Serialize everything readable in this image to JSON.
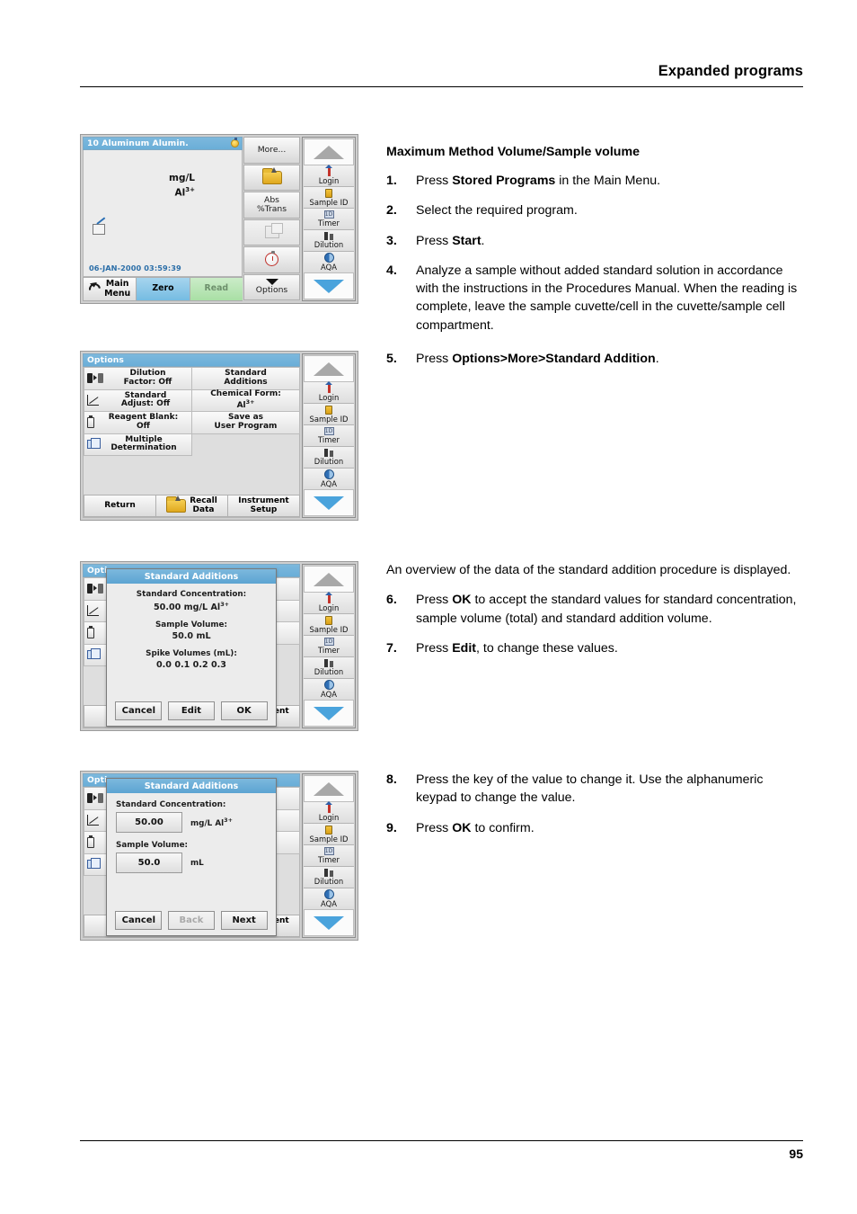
{
  "header": {
    "title": "Expanded programs"
  },
  "footer": {
    "page_number": "95"
  },
  "instructions": {
    "section_title": "Maximum Method Volume/Sample volume",
    "steps": [
      {
        "num": "1.",
        "pre": "Press ",
        "bold": "Stored Programs",
        "post": " in the Main Menu."
      },
      {
        "num": "2.",
        "pre": "Select the required program.",
        "bold": "",
        "post": ""
      },
      {
        "num": "3.",
        "pre": "Press ",
        "bold": "Start",
        "post": "."
      },
      {
        "num": "4.",
        "pre": "Analyze a sample without added standard solution in accordance with the instructions in the Procedures Manual. When the reading is complete, leave the sample cuvette/cell in the cuvette/sample cell compartment.",
        "bold": "",
        "post": ""
      },
      {
        "num": "5.",
        "pre": "Press ",
        "bold": "Options>More>Standard Addition",
        "post": "."
      },
      {
        "num": "6.",
        "pre": "Press ",
        "bold": "OK",
        "post": " to accept the standard values for standard concentration, sample volume (total) and standard addition volume."
      },
      {
        "num": "7.",
        "pre": "Press ",
        "bold": "Edit",
        "post": ", to change these values."
      },
      {
        "num": "8.",
        "pre": "Press the key of the value to change it. Use the alphanumeric keypad to change the value.",
        "bold": "",
        "post": ""
      },
      {
        "num": "9.",
        "pre": "Press ",
        "bold": "OK",
        "post": " to confirm."
      }
    ],
    "overview_paragraph": "An overview of the data of the standard addition procedure is displayed."
  },
  "screenshot_reading": {
    "title": "10 Aluminum Alumin.",
    "unit_line1": "mg/L",
    "unit_line2": "Al",
    "unit_line2_sup": "3+",
    "timestamp": "06-JAN-2000  03:59:39",
    "buttons": {
      "main_menu": "Main\nMenu",
      "main_menu_l1": "Main",
      "main_menu_l2": "Menu",
      "zero": "Zero",
      "read": "Read"
    },
    "softkeys": [
      {
        "label": "More...",
        "icon": ""
      },
      {
        "label": "",
        "icon": "folder-open-icon"
      },
      {
        "label": "Abs\n%Trans",
        "l1": "Abs",
        "l2": "%Trans",
        "icon": ""
      },
      {
        "label": "",
        "icon": "window-icon"
      },
      {
        "label": "",
        "icon": "timer-icon"
      },
      {
        "label": "Options",
        "icon": "triangle-down-icon"
      }
    ],
    "navkeys": [
      {
        "label": "Login",
        "icon": "login-icon"
      },
      {
        "label": "Sample ID",
        "icon": "sample-id-icon"
      },
      {
        "label": "Timer",
        "icon": "timer-icon"
      },
      {
        "label": "Dilution",
        "icon": "dilution-icon"
      },
      {
        "label": "AQA",
        "icon": "aqa-icon"
      }
    ]
  },
  "screenshot_options": {
    "title": "Options",
    "cells": [
      {
        "l1": "Dilution",
        "l2": "Factor: Off",
        "icon": "dilution-factor-icon"
      },
      {
        "l1": "Standard",
        "l2": "Additions",
        "icon": ""
      },
      {
        "l1": "Standard",
        "l2": "Adjust: Off",
        "icon": "standard-adjust-icon"
      },
      {
        "l1": "Chemical Form:",
        "l2": "Al",
        "l2_sup": "3+",
        "icon": ""
      },
      {
        "l1": "Reagent Blank:",
        "l2": "Off",
        "icon": "vial-icon"
      },
      {
        "l1": "Save as",
        "l2": "User Program",
        "icon": ""
      },
      {
        "l1": "Multiple",
        "l2": "Determination",
        "icon": "multiple-determination-icon"
      }
    ],
    "footer_buttons": [
      {
        "l1": "Return",
        "l2": "",
        "icon": ""
      },
      {
        "l1": "Recall",
        "l2": "Data",
        "icon": "folder-open-icon"
      },
      {
        "l1": "Instrument",
        "l2": "Setup",
        "icon": ""
      }
    ]
  },
  "dialog_overview": {
    "title": "Standard Additions",
    "std_conc_label": "Standard Concentration:",
    "std_conc_value": "50.00 mg/L Al",
    "std_conc_value_sup": "3+",
    "sample_vol_label": "Sample Volume:",
    "sample_vol_value": "50.0 mL",
    "spike_label": "Spike Volumes (mL):",
    "spike_value": "0.0 0.1 0.2 0.3",
    "buttons": {
      "cancel": "Cancel",
      "edit": "Edit",
      "ok": "OK"
    }
  },
  "dialog_edit": {
    "title": "Standard Additions",
    "std_conc_label": "Standard Concentration:",
    "std_conc_value": "50.00",
    "std_conc_unit": "mg/L Al",
    "std_conc_unit_sup": "3+",
    "sample_vol_label": "Sample Volume:",
    "sample_vol_value": "50.0",
    "sample_vol_unit": "mL",
    "buttons": {
      "cancel": "Cancel",
      "back": "Back",
      "next": "Next"
    }
  },
  "colors": {
    "titlebar_blue": "#6aaed8",
    "zero_blue": "#75bce2",
    "read_green": "#a9dfa5",
    "nav_down_blue": "#4aa3dc",
    "timestamp_blue": "#2b6ea8"
  }
}
